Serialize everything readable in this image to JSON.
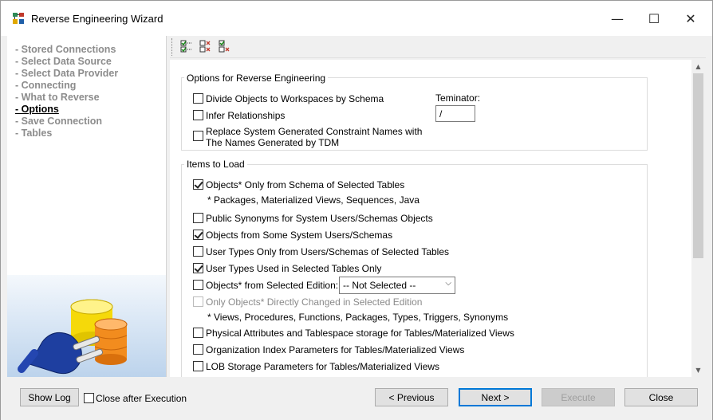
{
  "window": {
    "title": "Reverse Engineering Wizard",
    "min_glyph": "—",
    "max_glyph": "☐",
    "close_glyph": "✕"
  },
  "steps": [
    {
      "label": "- Stored Connections",
      "active": false
    },
    {
      "label": "- Select Data Source",
      "active": false
    },
    {
      "label": "- Select Data Provider",
      "active": false
    },
    {
      "label": "- Connecting",
      "active": false
    },
    {
      "label": "- What to Reverse",
      "active": false
    },
    {
      "label": "- Options",
      "active": true
    },
    {
      "label": "- Save Connection",
      "active": false
    },
    {
      "label": "- Tables",
      "active": false
    }
  ],
  "toolbar": {
    "icons": [
      "check-all-icon",
      "uncheck-all-icon",
      "invert-selection-icon"
    ]
  },
  "options_group": {
    "title": "Options for Reverse Engineering",
    "divide_objects": {
      "label": "Divide Objects to Workspaces by Schema",
      "checked": false
    },
    "infer_relationships": {
      "label": "Infer Relationships",
      "checked": false
    },
    "replace_names": {
      "label_line1": "Replace System Generated Constraint Names with",
      "label_line2": "The Names Generated by TDM",
      "checked": false
    },
    "terminator_label": "Teminator:",
    "terminator_value": "/"
  },
  "items_group": {
    "title": "Items to Load",
    "objects_only_schema": {
      "label": "Objects* Only from Schema of Selected Tables",
      "checked": true
    },
    "objects_note": "* Packages, Materialized Views, Sequences, Java",
    "public_synonyms": {
      "label": "Public Synonyms for System Users/Schemas Objects",
      "checked": false
    },
    "objects_system": {
      "label": "Objects from Some System Users/Schemas",
      "checked": true
    },
    "user_types_only": {
      "label": "User Types Only from Users/Schemas of Selected Tables",
      "checked": false
    },
    "user_types_used": {
      "label": "User Types Used in Selected Tables Only",
      "checked": true
    },
    "objects_edition": {
      "label": "Objects* from Selected Edition:",
      "checked": false
    },
    "edition_select": "-- Not Selected --",
    "only_changed": {
      "label": "Only Objects* Directly Changed in Selected Edition",
      "checked": false
    },
    "views_note": "* Views, Procedures, Functions, Packages, Types, Triggers, Synonyms",
    "physical_attrs": {
      "label": "Physical Attributes and Tablespace storage for Tables/Materialized Views",
      "checked": false
    },
    "org_index": {
      "label": "Organization Index Parameters for Tables/Materialized Views",
      "checked": false
    },
    "lob_storage": {
      "label": "LOB Storage Parameters for Tables/Materialized Views",
      "checked": false
    }
  },
  "footer": {
    "show_log": "Show Log",
    "close_after": {
      "label": "Close after Execution",
      "checked": false
    },
    "previous": "< Previous",
    "next": "Next >",
    "execute": "Execute",
    "close": "Close"
  }
}
